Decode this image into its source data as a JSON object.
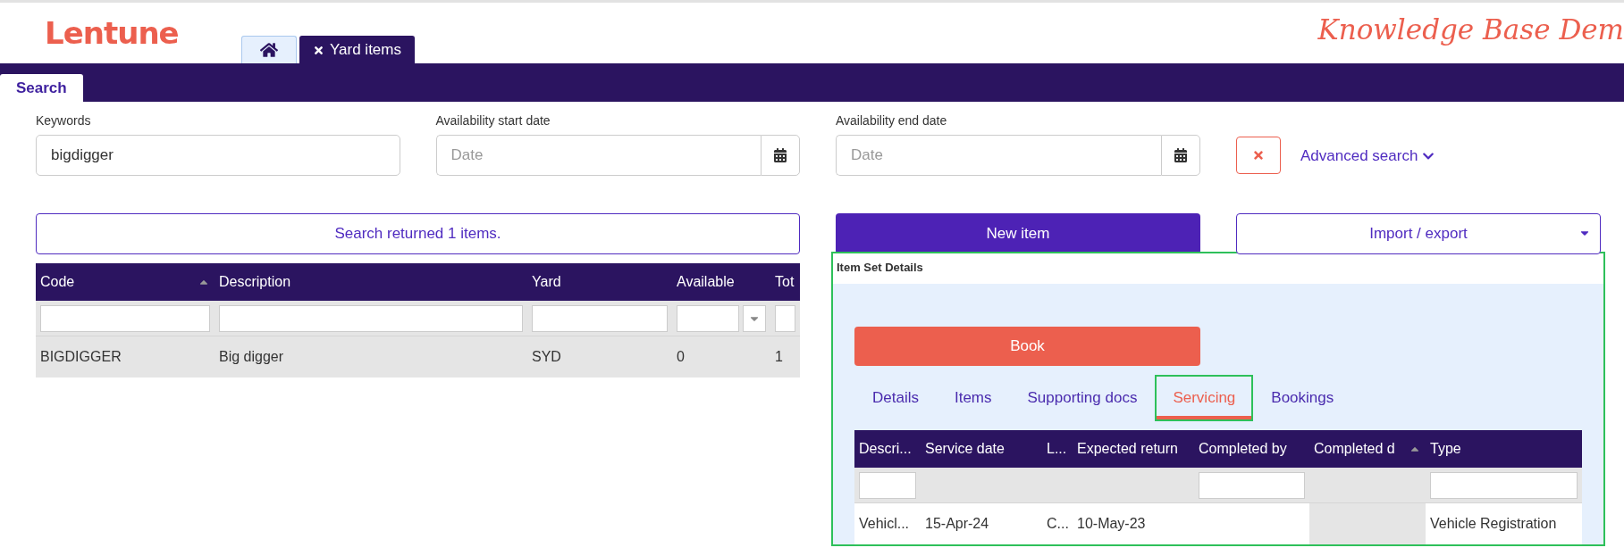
{
  "header": {
    "logo": "Lentune",
    "banner": "Knowledge Base Dem"
  },
  "page_tabs": [
    {
      "kind": "home",
      "selected": false
    },
    {
      "kind": "page",
      "label": "Yard items",
      "selected": true
    }
  ],
  "sub_tabs": [
    {
      "label": "Search",
      "selected": true
    }
  ],
  "search": {
    "keywords": {
      "label": "Keywords",
      "value": "bigdigger"
    },
    "start_date": {
      "label": "Availability start date",
      "placeholder": "Date"
    },
    "end_date": {
      "label": "Availability end date",
      "placeholder": "Date"
    },
    "advanced_search": "Advanced search"
  },
  "result_message": "Search returned 1 items.",
  "actions": {
    "new_item": "New item",
    "import_export": "Import / export"
  },
  "items_table": {
    "columns": [
      {
        "label": "Code",
        "sorted": true,
        "filter": {
          "kind": "text"
        }
      },
      {
        "label": "Description",
        "sorted": false,
        "filter": {
          "kind": "text"
        }
      },
      {
        "label": "Yard",
        "sorted": false,
        "filter": {
          "kind": "text"
        }
      },
      {
        "label": "Available",
        "sorted": false,
        "filter": {
          "kind": "select"
        }
      },
      {
        "label": "Tot",
        "sorted": false,
        "filter": {
          "kind": "text"
        }
      }
    ],
    "rows": [
      {
        "selected": true,
        "cells": [
          "BIGDIGGER",
          "Big digger",
          "SYD",
          "0",
          "1"
        ]
      }
    ]
  },
  "detail_panel": {
    "title": "Item Set Details",
    "highlighted": true,
    "book": "Book",
    "tabs": [
      {
        "label": "Details",
        "selected": false,
        "highlighted": false
      },
      {
        "label": "Items",
        "selected": false,
        "highlighted": false
      },
      {
        "label": "Supporting docs",
        "selected": false,
        "highlighted": false
      },
      {
        "label": "Servicing",
        "selected": true,
        "highlighted": true
      },
      {
        "label": "Bookings",
        "selected": false,
        "highlighted": false
      }
    ],
    "servicing_table": {
      "columns": [
        {
          "label": "Descri...",
          "sorted": false,
          "filter": {
            "kind": "text"
          }
        },
        {
          "label": "Service date",
          "sorted": false
        },
        {
          "label": "L...",
          "sorted": false
        },
        {
          "label": "Expected return",
          "sorted": false
        },
        {
          "label": "Completed by",
          "sorted": false,
          "filter": {
            "kind": "text"
          }
        },
        {
          "label": "Completed d",
          "sorted": true
        },
        {
          "label": "Type",
          "sorted": false,
          "filter": {
            "kind": "text"
          }
        }
      ],
      "rows": [
        {
          "selected": false,
          "cells": [
            "Vehicl...",
            "15-Apr-24",
            "C...",
            "10-May-23",
            null,
            null,
            "Vehicle Registration"
          ]
        }
      ]
    }
  }
}
